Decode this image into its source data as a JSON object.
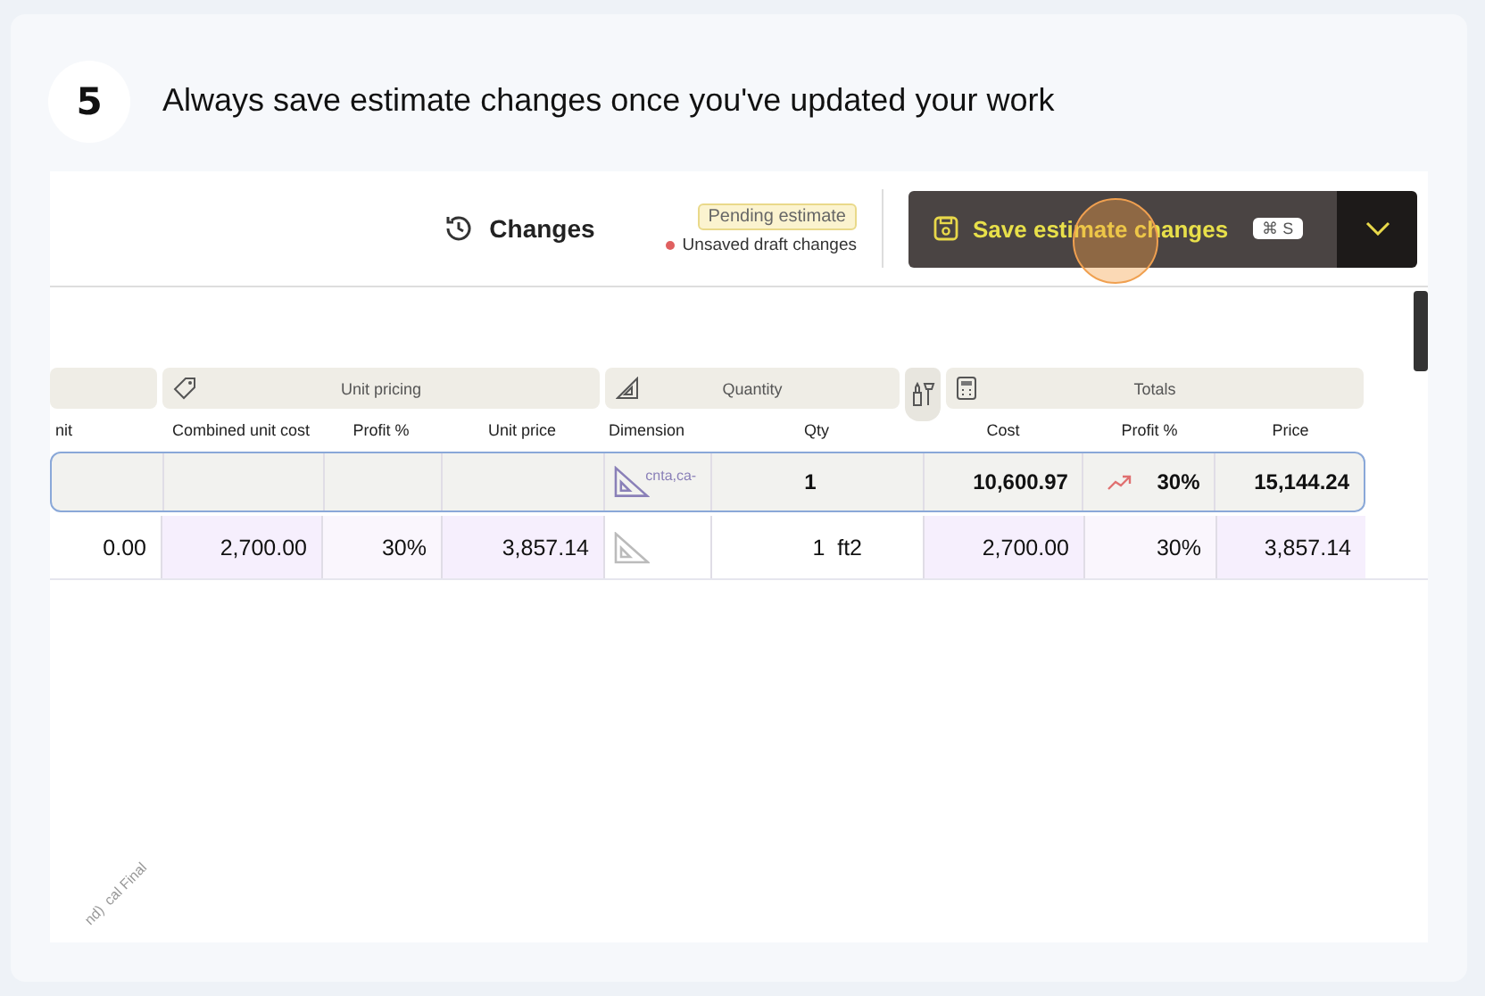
{
  "step": {
    "number": "5",
    "text": "Always save estimate changes once you've updated your work"
  },
  "toolbar": {
    "changes_label": "Changes",
    "status_badge": "Pending estimate",
    "draft_note": "Unsaved draft changes",
    "save_label": "Save estimate changes",
    "shortcut": "⌘ S"
  },
  "group_headers": [
    {
      "kind": "blank"
    },
    {
      "kind": "tag",
      "label": "Unit pricing"
    },
    {
      "kind": "ruler",
      "label": "Quantity"
    },
    {
      "kind": "tools"
    },
    {
      "kind": "calculator",
      "label": "Totals"
    }
  ],
  "columns": [
    "nit",
    "Combined unit cost",
    "Profit %",
    "Unit price",
    "Dimension",
    "Qty",
    "Cost",
    "Profit %",
    "Price"
  ],
  "rows": [
    {
      "kind": "summary",
      "cells": [
        {
          "kind": "blank"
        },
        {
          "kind": "blank"
        },
        {
          "kind": "blank"
        },
        {
          "kind": "blank"
        },
        {
          "kind": "dimension",
          "text": "cnta,ca-"
        },
        {
          "kind": "center",
          "text": "1"
        },
        {
          "kind": "plain",
          "text": "10,600.97"
        },
        {
          "kind": "trend",
          "text": "30%"
        },
        {
          "kind": "plain",
          "text": "15,144.24"
        }
      ]
    },
    {
      "kind": "item",
      "cells": [
        {
          "kind": "plain",
          "text": "0.00"
        },
        {
          "kind": "purple",
          "text": "2,700.00"
        },
        {
          "kind": "light",
          "text": "30%"
        },
        {
          "kind": "purple",
          "text": "3,857.14"
        },
        {
          "kind": "dimension"
        },
        {
          "kind": "qty",
          "text": "1  ft2"
        },
        {
          "kind": "purple",
          "text": "2,700.00"
        },
        {
          "kind": "light",
          "text": "30%"
        },
        {
          "kind": "purple",
          "text": "3,857.14"
        }
      ]
    }
  ],
  "footer_marks": [
    "nd)",
    "cal Final"
  ]
}
